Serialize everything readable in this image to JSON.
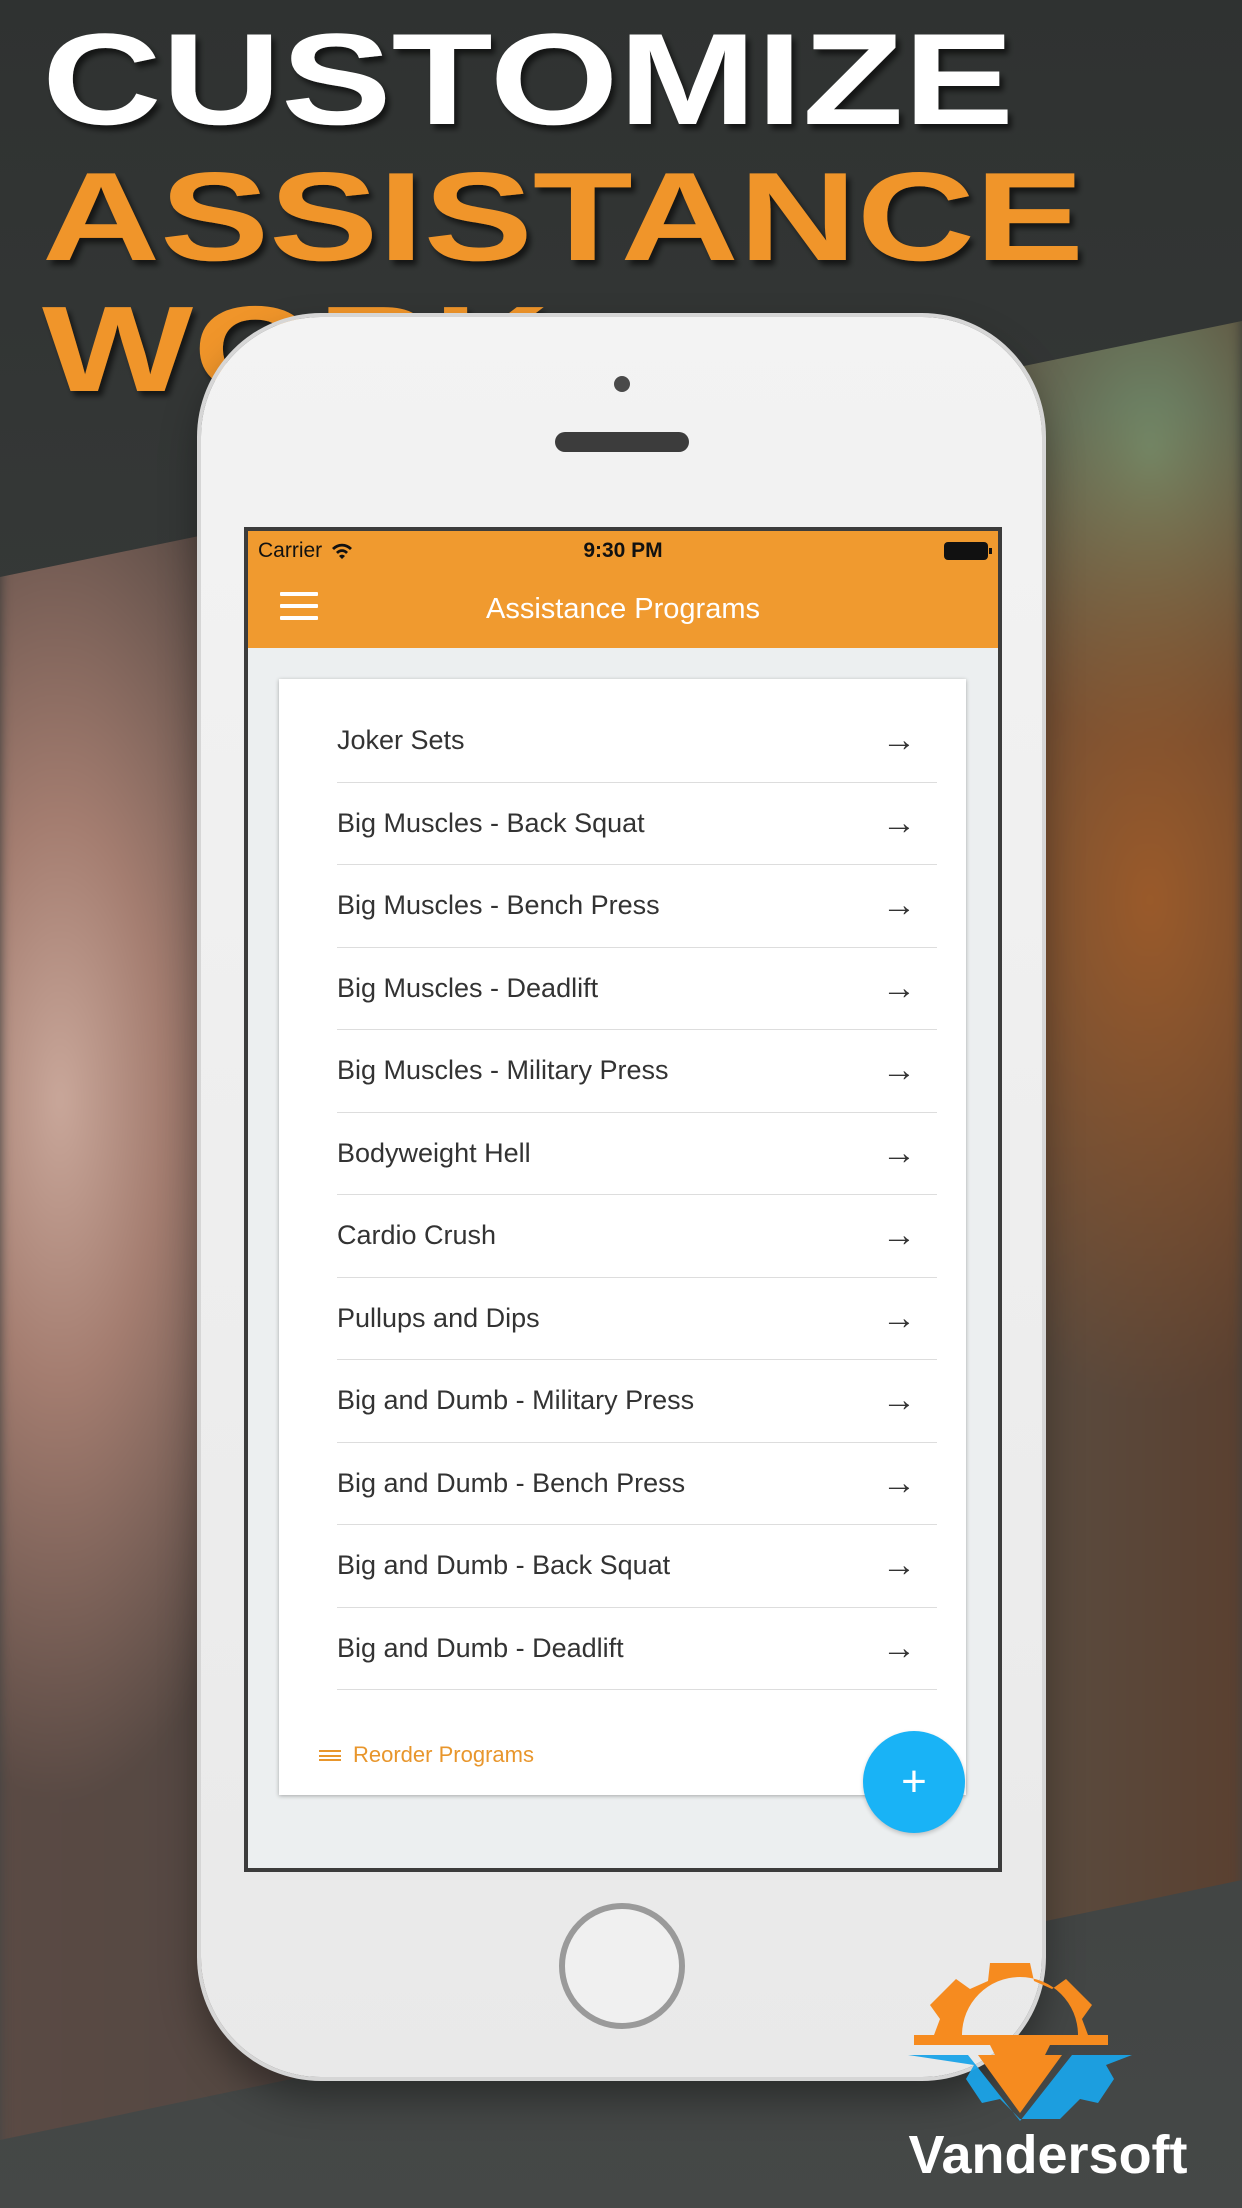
{
  "headline": {
    "line1": "CUSTOMIZE",
    "line2": "ASSISTANCE",
    "line3": "WORK"
  },
  "colors": {
    "accent": "#f09a2f",
    "fab": "#19b3f6",
    "headline_orange": "#f0952a"
  },
  "status_bar": {
    "carrier": "Carrier",
    "time": "9:30 PM"
  },
  "app_bar": {
    "title": "Assistance Programs",
    "menu_icon": "hamburger-icon"
  },
  "programs": [
    {
      "label": "Joker Sets"
    },
    {
      "label": "Big Muscles - Back Squat"
    },
    {
      "label": "Big Muscles - Bench Press"
    },
    {
      "label": "Big Muscles - Deadlift"
    },
    {
      "label": "Big Muscles - Military Press"
    },
    {
      "label": "Bodyweight Hell"
    },
    {
      "label": "Cardio Crush"
    },
    {
      "label": "Pullups and Dips"
    },
    {
      "label": "Big and Dumb - Military Press"
    },
    {
      "label": "Big and Dumb - Bench Press"
    },
    {
      "label": "Big and Dumb - Back Squat"
    },
    {
      "label": "Big and Dumb - Deadlift"
    }
  ],
  "arrow_glyph": "→",
  "reorder_label": "Reorder Programs",
  "fab_label": "+",
  "brand": "Vandersoft"
}
